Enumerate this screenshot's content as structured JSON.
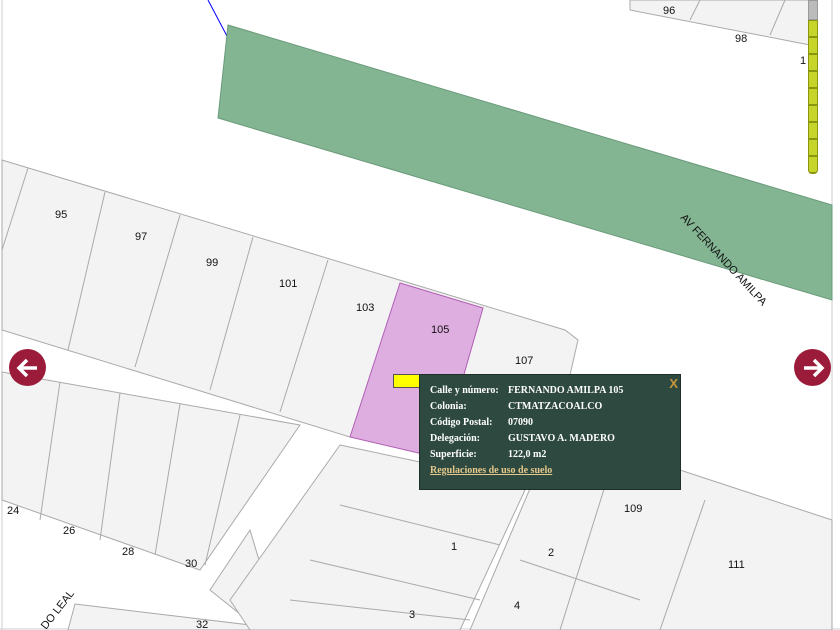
{
  "map": {
    "street_labels": [
      "AV FERNANDO AMILPA",
      "DO LEAL"
    ],
    "lot_numbers": {
      "96": "96",
      "98": "98",
      "1top": "1",
      "95": "95",
      "97": "97",
      "99": "99",
      "101": "101",
      "103": "103",
      "105": "105",
      "107": "107",
      "109": "109",
      "111": "111",
      "24": "24",
      "26": "26",
      "28": "28",
      "30": "30",
      "32": "32",
      "1": "1",
      "2": "2",
      "3": "3",
      "4": "4"
    },
    "colors": {
      "road_strip": "#84b593",
      "selected_lot": "#dfaee0",
      "lot_fill": "#f3f3f3",
      "nav": "#9b1c3a"
    }
  },
  "popup": {
    "rows": [
      {
        "key": "Calle y número:",
        "value": "FERNANDO AMILPA 105"
      },
      {
        "key": "Colonia:",
        "value": "CTMATZACOALCO"
      },
      {
        "key": "Código Postal:",
        "value": "07090"
      },
      {
        "key": "Delegación:",
        "value": "GUSTAVO A. MADERO"
      },
      {
        "key": "Superficie:",
        "value": "122,0 m2"
      }
    ],
    "link": "Regulaciones de uso de suelo",
    "close": "X"
  }
}
